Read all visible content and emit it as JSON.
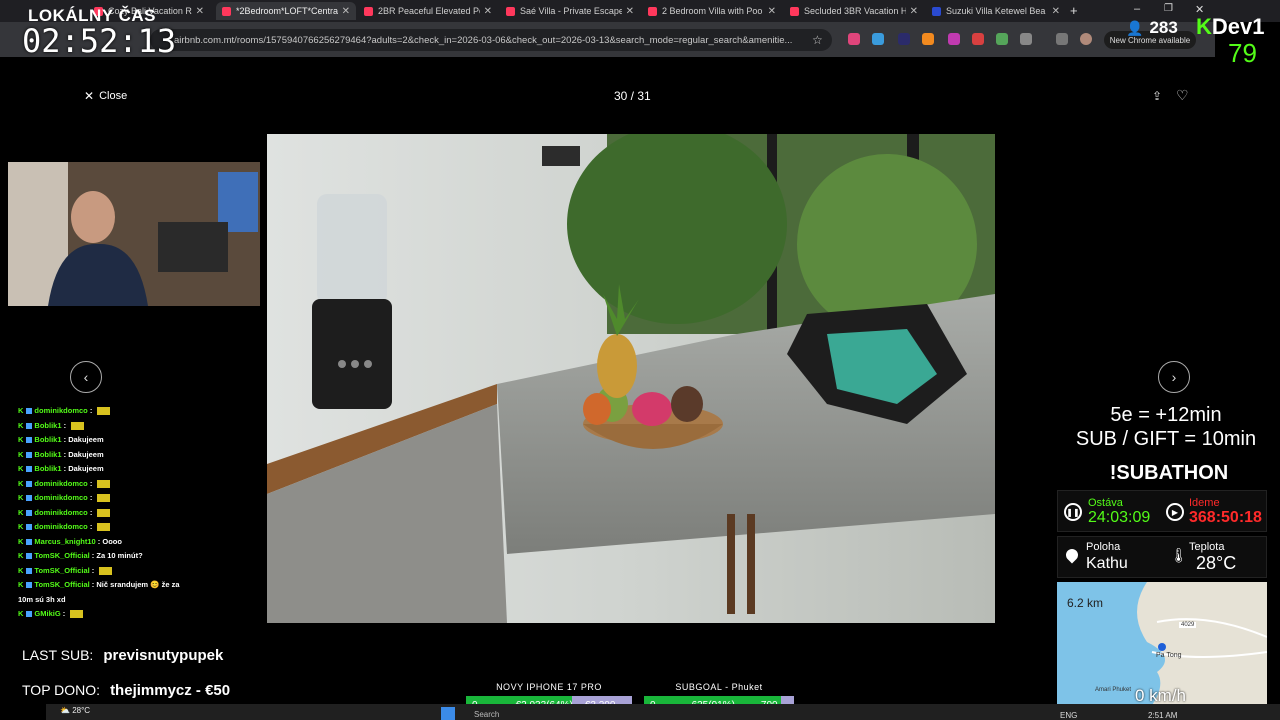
{
  "browser": {
    "tabs": [
      {
        "label": "Cozy Bali Vacation Re",
        "active": false
      },
      {
        "label": "*2Bedroom*LOFT*Centra",
        "active": true
      },
      {
        "label": "2BR Peaceful Elevated Po",
        "active": false
      },
      {
        "label": "Saé Villa - Private Escape",
        "active": false
      },
      {
        "label": "2 Bedroom Villa with Poo",
        "active": false
      },
      {
        "label": "Secluded 3BR Vacation H",
        "active": false
      },
      {
        "label": "Suzuki Villa Ketewel Bea",
        "active": false
      }
    ],
    "url": "airbnb.com.mt/rooms/1575940766256279464?adults=2&check_in=2026-03-06&check_out=2026-03-13&search_mode=regular_search&amenitie...",
    "update_label": "New Chrome available"
  },
  "stream": {
    "clock_label": "LOKÁLNY ČAS",
    "clock_time": "02:52:13",
    "viewers": "283",
    "brand": "Dev1",
    "brand_k": "K",
    "brand_num": "79",
    "last_sub_label": "LAST SUB:",
    "last_sub_name": "previsnutypupek",
    "top_dono_label": "TOP DONO:",
    "top_dono_value": "thejimmycz - €50",
    "rate_line1": "5e = +12min",
    "rate_line2": "SUB / GIFT = 10min",
    "subathon": "!SUBATHON",
    "ostava_label": "Ostáva",
    "ostava_value": "24:03:09",
    "ideme_label": "Ideme",
    "ideme_value": "368:50:18",
    "poloha_label": "Poloha",
    "poloha_value": "Kathu",
    "teplota_label": "Teplota",
    "teplota_value": "28°C",
    "map_distance": "6.2 km",
    "map_speed": "0 km/h",
    "map_label": "Pa Tong",
    "map_label2": "Amari Phuket",
    "map_road": "4029"
  },
  "viewer": {
    "close_label": "Close",
    "counter": "30 / 31"
  },
  "chat": [
    {
      "user": "dominikdomco",
      "text": ""
    },
    {
      "user": "Boblik1",
      "text": ""
    },
    {
      "user": "Boblik1",
      "text": "Dakujeem"
    },
    {
      "user": "Boblik1",
      "text": "Dakujeem"
    },
    {
      "user": "Boblik1",
      "text": "Dakujeem"
    },
    {
      "user": "dominikdomco",
      "text": ""
    },
    {
      "user": "dominikdomco",
      "text": ""
    },
    {
      "user": "dominikdomco",
      "text": ""
    },
    {
      "user": "dominikdomco",
      "text": ""
    },
    {
      "user": "Marcus_knight10",
      "text": "Oooo"
    },
    {
      "user": "TomSK_Official",
      "text": "Za 10 minút?"
    },
    {
      "user": "TomSK_Official",
      "text": ""
    },
    {
      "user": "TomSK_Official",
      "text": "Nič srandujem 😊 že za"
    },
    {
      "user": "",
      "text": "10m sú 3h xd"
    },
    {
      "user": "GMikiG",
      "text": ""
    }
  ],
  "goals": {
    "g1_title": "NOVY IPHONE 17 PRO",
    "g1_start": "0",
    "g1_value": "€2,033(64%)",
    "g1_end": "€3,200",
    "g1_fraction": 0.64,
    "g2_title": "SUBGOAL - Phuket",
    "g2_start": "0",
    "g2_value": "635(91%)",
    "g2_end": "700",
    "g2_fraction": 0.91
  },
  "taskbar": {
    "weather": "28°C",
    "search": "Search",
    "lang": "ENG",
    "time": "2:51 AM"
  }
}
